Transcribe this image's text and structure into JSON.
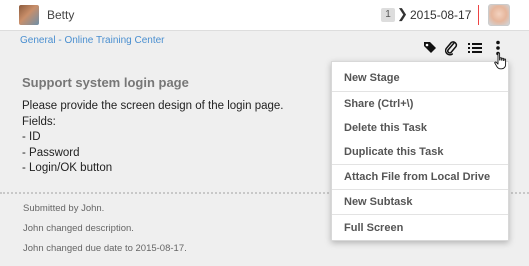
{
  "header": {
    "user_name": "Betty",
    "stage_number": "1",
    "due_date": "2015-08-17"
  },
  "breadcrumb": "General - Online Training Center",
  "toolbar": {
    "icons": [
      "tag-icon",
      "paperclip-icon",
      "list-icon",
      "more-vertical-icon"
    ]
  },
  "task": {
    "title": "Support system login page",
    "description": "Please provide the screen design of the login page.\nFields:\n- ID\n- Password\n- Login/OK button"
  },
  "activity": [
    "Submitted by John.",
    "John changed description.",
    "John changed due date to 2015-08-17."
  ],
  "menu": {
    "items": [
      "New Stage",
      "Share (Ctrl+\\)",
      "Delete this Task",
      "Duplicate this Task",
      "Attach File from Local Drive",
      "New Subtask",
      "Full Screen"
    ]
  },
  "colors": {
    "link": "#4a8fd0",
    "panel_bg": "#efefef",
    "separator_red": "#e44444"
  }
}
